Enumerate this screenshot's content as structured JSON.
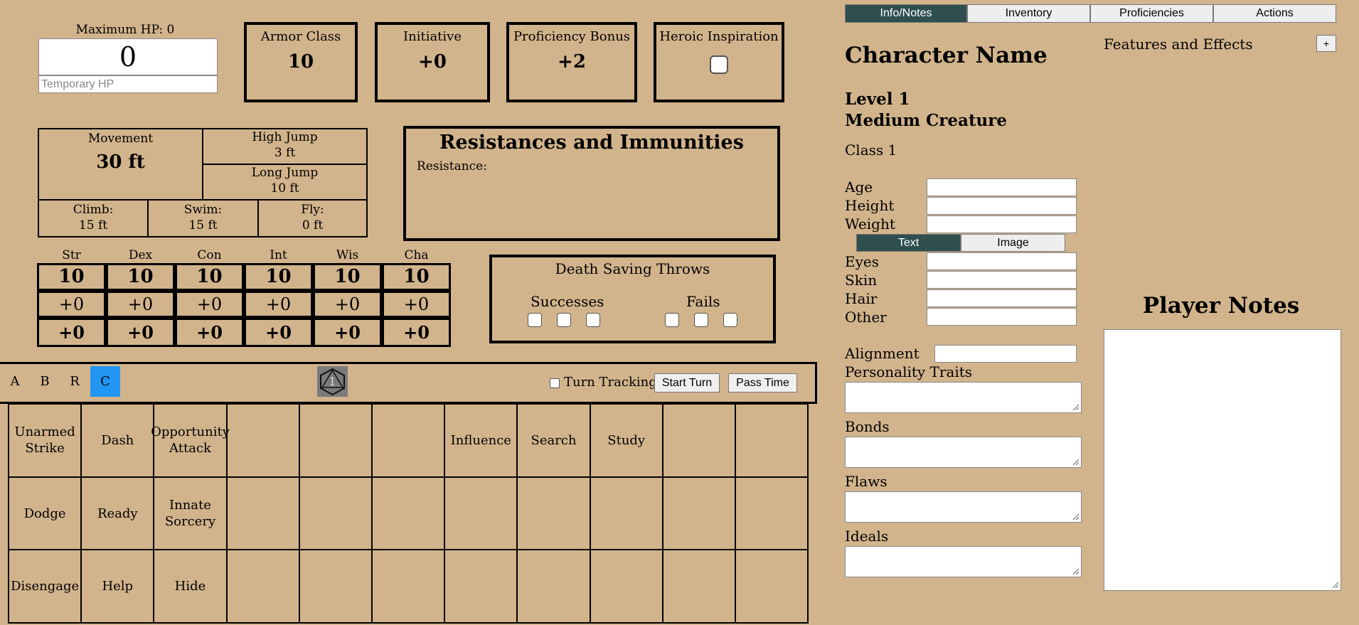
{
  "hp": {
    "max_label": "Maximum HP: 0",
    "current": "0",
    "temp_placeholder": "Temporary HP"
  },
  "stats": {
    "armor_class": {
      "label": "Armor Class",
      "value": "10"
    },
    "initiative": {
      "label": "Initiative",
      "value": "+0"
    },
    "proficiency": {
      "label": "Proficiency Bonus",
      "value": "+2"
    },
    "inspiration": {
      "label": "Heroic Inspiration"
    }
  },
  "movement": {
    "label": "Movement",
    "value": "30 ft",
    "high_jump": {
      "label": "High Jump",
      "value": "3 ft"
    },
    "long_jump": {
      "label": "Long Jump",
      "value": "10 ft"
    },
    "climb": {
      "label": "Climb:",
      "value": "15 ft"
    },
    "swim": {
      "label": "Swim:",
      "value": "15 ft"
    },
    "fly": {
      "label": "Fly:",
      "value": "0 ft"
    }
  },
  "resist": {
    "title": "Resistances and Immunities",
    "line": "Resistance:"
  },
  "abilities": [
    {
      "name": "Str",
      "score": "10",
      "mod": "+0",
      "save": "+0"
    },
    {
      "name": "Dex",
      "score": "10",
      "mod": "+0",
      "save": "+0"
    },
    {
      "name": "Con",
      "score": "10",
      "mod": "+0",
      "save": "+0"
    },
    {
      "name": "Int",
      "score": "10",
      "mod": "+0",
      "save": "+0"
    },
    {
      "name": "Wis",
      "score": "10",
      "mod": "+0",
      "save": "+0"
    },
    {
      "name": "Cha",
      "score": "10",
      "mod": "+0",
      "save": "+0"
    }
  ],
  "death": {
    "title": "Death Saving Throws",
    "successes": "Successes",
    "fails": "Fails"
  },
  "toolbar": {
    "tabs": [
      "A",
      "B",
      "R",
      "C"
    ],
    "d20": "1",
    "turn_tracking": "Turn Tracking",
    "start_turn": "Start Turn",
    "pass_time": "Pass Time"
  },
  "actions": [
    [
      "Unarmed Strike",
      "Dash",
      "Opportunity Attack",
      "",
      "",
      "",
      "Influence",
      "Search",
      "Study",
      "",
      ""
    ],
    [
      "Dodge",
      "Ready",
      "Innate Sorcery",
      "",
      "",
      "",
      "",
      "",
      "",
      "",
      ""
    ],
    [
      "Disengage",
      "Help",
      "Hide",
      "",
      "",
      "",
      "",
      "",
      "",
      "",
      ""
    ]
  ],
  "tabs": [
    "Info/Notes",
    "Inventory",
    "Proficiencies",
    "Actions"
  ],
  "info": {
    "name": "Character Name",
    "level": "Level 1",
    "size": "Medium Creature",
    "class": "Class 1",
    "age": "Age",
    "height": "Height",
    "weight": "Weight",
    "text_tab": "Text",
    "image_tab": "Image",
    "eyes": "Eyes",
    "skin": "Skin",
    "hair": "Hair",
    "other": "Other",
    "alignment": "Alignment",
    "personality": "Personality Traits",
    "bonds": "Bonds",
    "flaws": "Flaws",
    "ideals": "Ideals"
  },
  "features": {
    "title": "Features and Effects",
    "add": "+"
  },
  "notes": {
    "title": "Player Notes"
  },
  "colors": {
    "background": "#d2b48c",
    "tab_active": "#2f4f4f",
    "toolbar_active": "#2196f3"
  }
}
